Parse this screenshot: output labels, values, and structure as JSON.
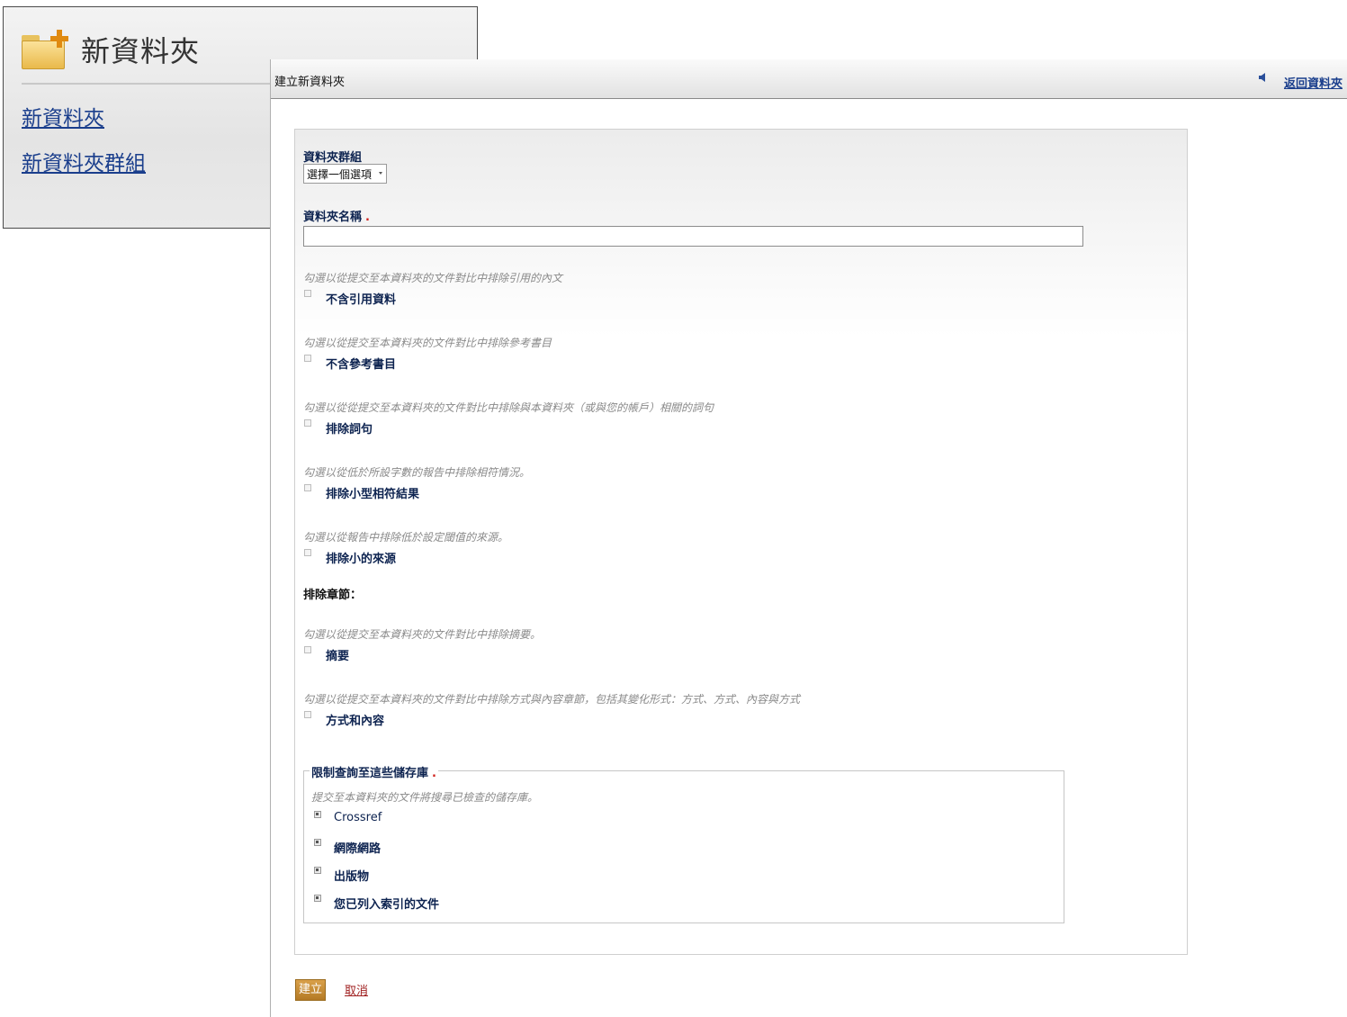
{
  "menu": {
    "title": "新資料夾",
    "links": [
      "新資料夾",
      "新資料夾群組"
    ]
  },
  "dialog": {
    "title": "建立新資料夾",
    "back_link": "返回資料夾"
  },
  "form": {
    "folder_group_label": "資料夾群組",
    "folder_group_select": "選擇一個選項",
    "folder_name_label": "資料夾名稱",
    "required_mark": ".",
    "options": [
      {
        "hint": "勾選以從提交至本資料夾的文件對比中排除引用的內文",
        "label": "不含引用資料"
      },
      {
        "hint": "勾選以從提交至本資料夾的文件對比中排除參考書目",
        "label": "不含參考書目"
      },
      {
        "hint": "勾選以從從提交至本資料夾的文件對比中排除與本資料夾（或與您的帳戶）相關的詞句",
        "label": "排除詞句"
      },
      {
        "hint": "勾選以從低於所設字數的報告中排除相符情況。",
        "label": "排除小型相符結果"
      },
      {
        "hint": "勾選以從報告中排除低於設定閾值的來源。",
        "label": "排除小的來源"
      }
    ],
    "exclude_sections_title": "排除章節：",
    "section_options": [
      {
        "hint": "勾選以從提交至本資料夾的文件對比中排除摘要。",
        "label": "摘要"
      },
      {
        "hint": "勾選以從提交至本資料夾的文件對比中排除方式與內容章節，包括其變化形式：方式、方式、內容與方式",
        "label": "方式和內容"
      }
    ],
    "repositories": {
      "legend": "限制查詢至這些儲存庫",
      "hint": "提交至本資料夾的文件將搜尋已檢查的儲存庫。",
      "items": [
        "Crossref",
        "網際網路",
        "出版物",
        "您已列入索引的文件"
      ]
    }
  },
  "buttons": {
    "create": "建立",
    "cancel": "取消"
  },
  "colors": {
    "label_text": "#0d2350",
    "link": "#1a3e8c",
    "required": "#d0201b",
    "create_button": "#c58c35"
  }
}
